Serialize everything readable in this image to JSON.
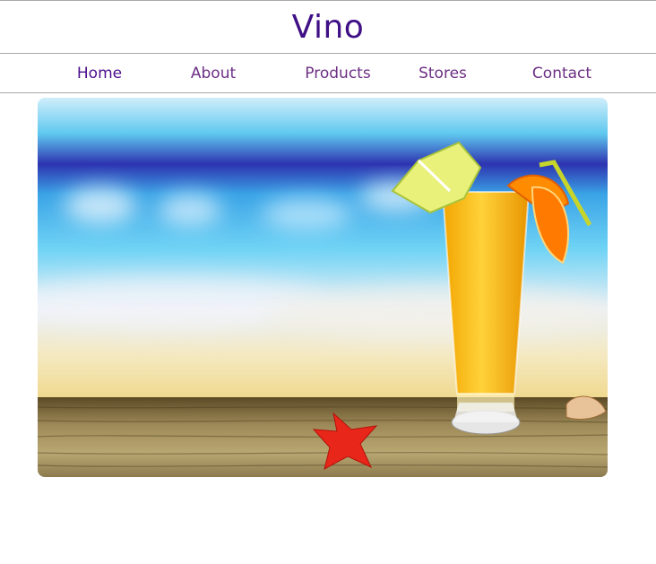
{
  "brand": {
    "name": "Vino"
  },
  "nav": {
    "items": [
      {
        "label": "Home",
        "active": true
      },
      {
        "label": "About",
        "active": false
      },
      {
        "label": "Products",
        "active": false
      },
      {
        "label": "Stores",
        "active": false
      },
      {
        "label": "Contact",
        "active": false
      }
    ]
  },
  "hero": {
    "icon": "tropical-drink-image",
    "colors": {
      "sky": "#4fc7f0",
      "sea": "#2b2aa8",
      "drink": "#f7b80e",
      "starfish": "#e8261a",
      "table": "#8c7a4e"
    }
  },
  "theme": {
    "brand_color": "#3f0f86",
    "nav_color": "#6c2f84"
  }
}
